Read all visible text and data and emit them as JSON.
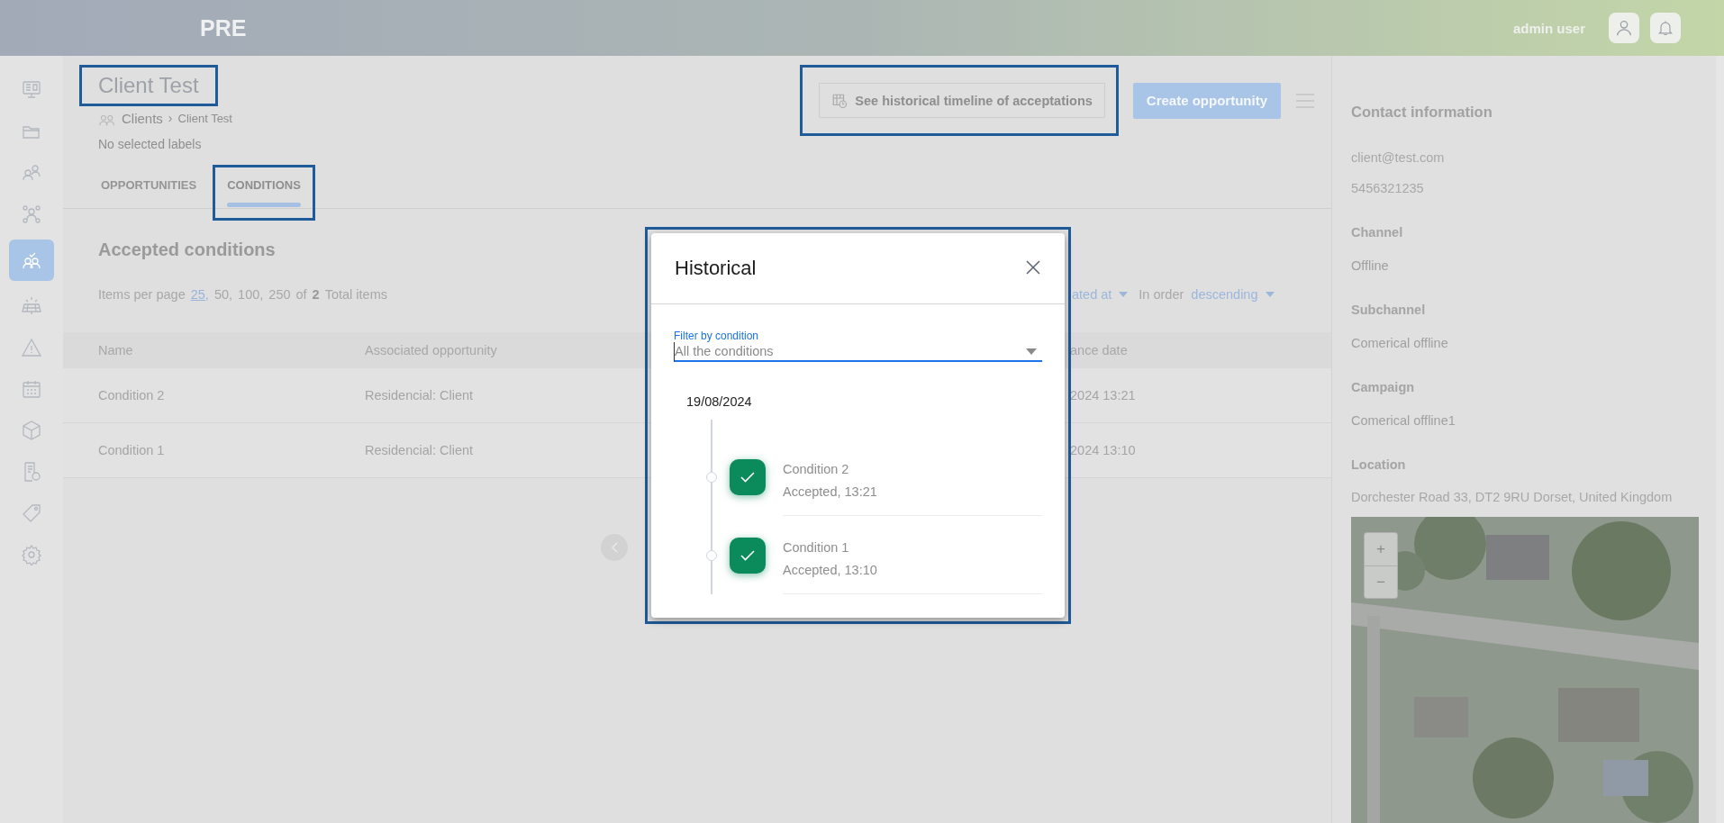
{
  "header": {
    "brand": "PRE",
    "user_name": "admin user"
  },
  "sidebar": {
    "items": [
      {
        "selected": false
      },
      {
        "selected": false
      },
      {
        "selected": false
      },
      {
        "selected": false
      },
      {
        "selected": true
      },
      {
        "selected": false
      },
      {
        "selected": false
      },
      {
        "selected": false
      },
      {
        "selected": false
      },
      {
        "selected": false
      },
      {
        "selected": false
      },
      {
        "selected": false
      }
    ]
  },
  "page": {
    "title": "Client Test",
    "highlighted": true,
    "breadcrumb": {
      "root": "Clients",
      "separator": "›",
      "current": "Client Test"
    },
    "labels": "No selected labels"
  },
  "actions": {
    "history_button": "See historical timeline of acceptations",
    "highlighted": true,
    "create_button": "Create opportunity"
  },
  "tabs": [
    {
      "label": "OPPORTUNITIES",
      "selected": false,
      "highlighted": false
    },
    {
      "label": "CONDITIONS",
      "selected": true,
      "highlighted": true
    }
  ],
  "section_title": "Accepted conditions",
  "pagination": {
    "label": "Items per page",
    "options": [
      {
        "label": "25,",
        "selected": true
      },
      {
        "label": "50,",
        "selected": false
      },
      {
        "label": "100,",
        "selected": false
      },
      {
        "label": "250",
        "selected": false
      }
    ],
    "of": "of",
    "total": "2",
    "total_label": "Total items"
  },
  "sort": {
    "field": "ated at",
    "order_label": "In order",
    "order": "descending"
  },
  "table": {
    "columns": [
      "Name",
      "Associated opportunity",
      "ance date"
    ],
    "rows": [
      [
        "Condition 2",
        "Residencial: Client",
        "2024 13:21"
      ],
      [
        "Condition 1",
        "Residencial: Client",
        "2024 13:10"
      ]
    ]
  },
  "contact": {
    "title": "Contact information",
    "email": "client@test.com",
    "phone": "5456321235",
    "fields": [
      {
        "label": "Channel",
        "value": "Offline"
      },
      {
        "label": "Subchannel",
        "value": "Comerical offline"
      },
      {
        "label": "Campaign",
        "value": "Comerical offline1"
      }
    ],
    "location_label": "Location",
    "address": "Dorchester Road 33, DT2 9RU Dorset, United Kingdom",
    "map": {
      "kind": "picture",
      "zoom_controls": [
        "+",
        "−"
      ]
    }
  },
  "modal": {
    "title": "Historical",
    "highlighted": true,
    "filter": {
      "label": "Filter by condition",
      "value": "All the conditions"
    },
    "date": "19/08/2024",
    "entries": [
      {
        "name": "Condition 2",
        "status": "Accepted, 13:21"
      },
      {
        "name": "Condition 1",
        "status": "Accepted, 13:10"
      }
    ]
  }
}
